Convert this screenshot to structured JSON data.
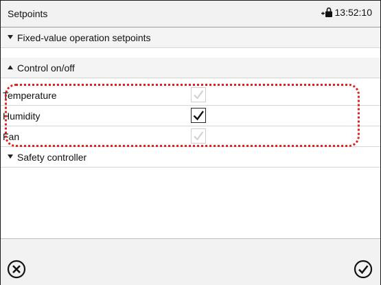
{
  "header": {
    "title": "Setpoints",
    "time": "13:52:10",
    "lock_icon": "lock-icon"
  },
  "list": {
    "group_fixed": {
      "label": "Fixed-value operation setpoints",
      "icon": "triangle-down-icon",
      "expanded": false
    },
    "group_control": {
      "label": "Control on/off",
      "icon": "triangle-up-icon",
      "expanded": true
    },
    "items": [
      {
        "label": "Temperature",
        "checked": true,
        "enabled": false
      },
      {
        "label": "Humidity",
        "checked": true,
        "enabled": true
      },
      {
        "label": "Fan",
        "checked": true,
        "enabled": false
      }
    ],
    "group_safety": {
      "label": "Safety controller",
      "icon": "triangle-down-icon",
      "expanded": false
    }
  },
  "footer": {
    "cancel_icon": "close-circle-icon",
    "confirm_icon": "check-circle-icon"
  },
  "colors": {
    "highlight": "#e02020",
    "header_bg": "#f2f2f2",
    "text": "#111111"
  }
}
